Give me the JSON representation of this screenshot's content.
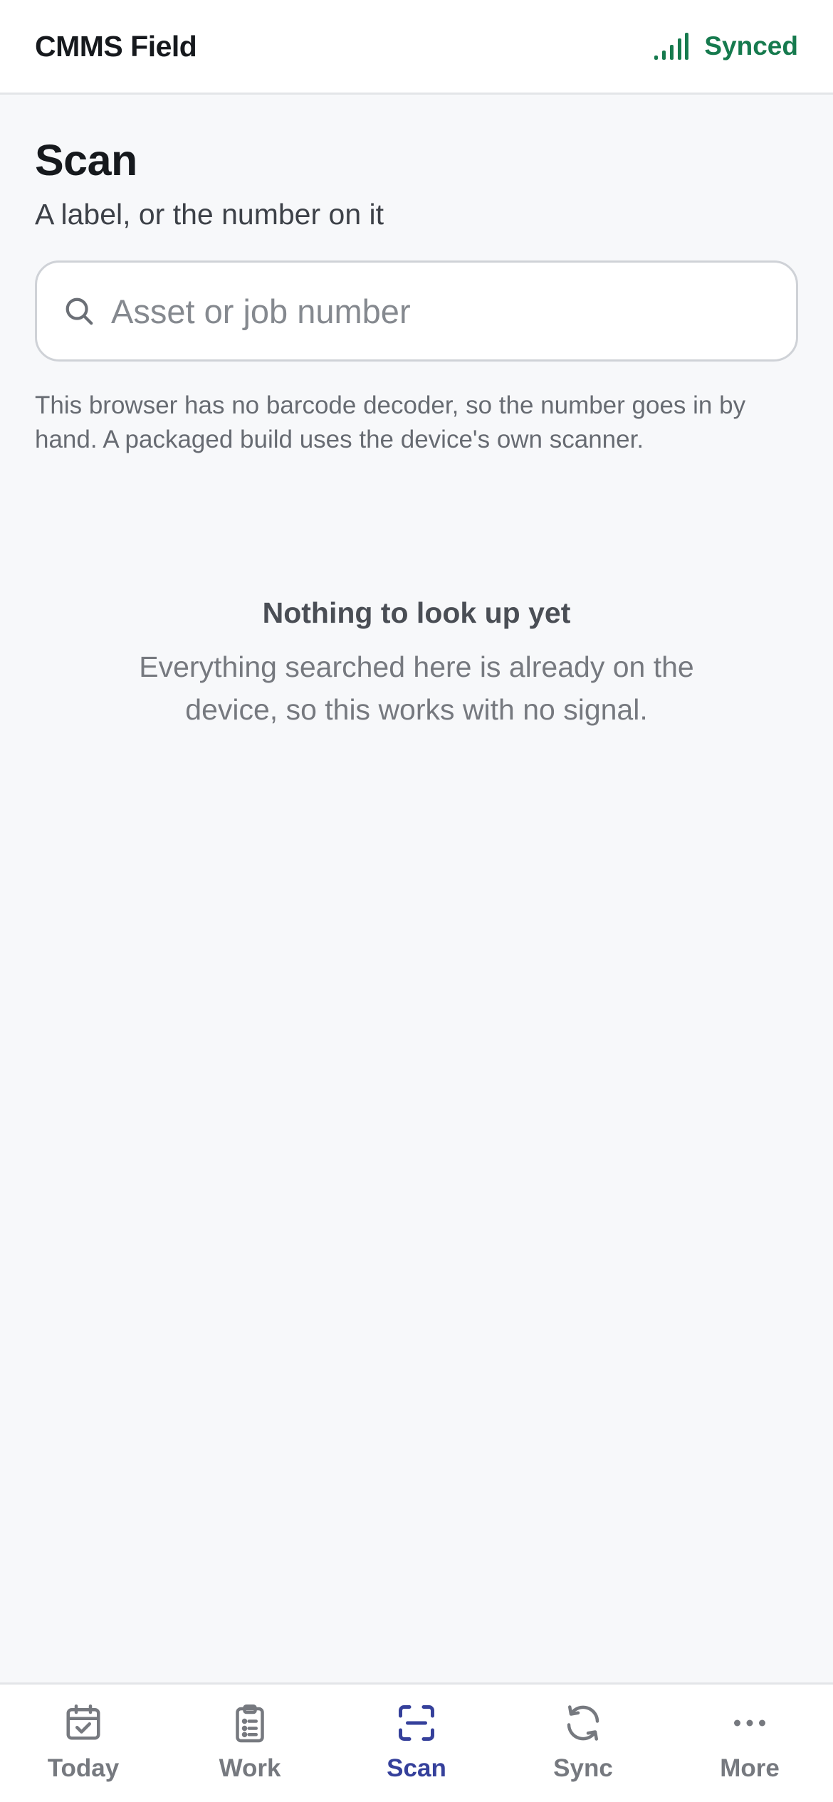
{
  "header": {
    "title": "CMMS Field",
    "sync_status": "Synced",
    "sync_icon": "signal-bars-icon",
    "sync_color": "#167a4e"
  },
  "main": {
    "title": "Scan",
    "subtitle": "A label, or the number on it",
    "search": {
      "placeholder": "Asset or job number",
      "value": "",
      "icon": "search-icon"
    },
    "helper_text": "This browser has no barcode decoder, so the number goes in by hand. A packaged build uses the device's own scanner.",
    "empty_state": {
      "title": "Nothing to look up yet",
      "description": "Everything searched here is already on the device, so this works with no signal."
    }
  },
  "bottom_nav": {
    "active_color": "#35409b",
    "items": [
      {
        "label": "Today",
        "icon": "calendar-check-icon",
        "active": false
      },
      {
        "label": "Work",
        "icon": "clipboard-list-icon",
        "active": false
      },
      {
        "label": "Scan",
        "icon": "scan-frame-icon",
        "active": true
      },
      {
        "label": "Sync",
        "icon": "refresh-icon",
        "active": false
      },
      {
        "label": "More",
        "icon": "more-dots-icon",
        "active": false
      }
    ]
  }
}
